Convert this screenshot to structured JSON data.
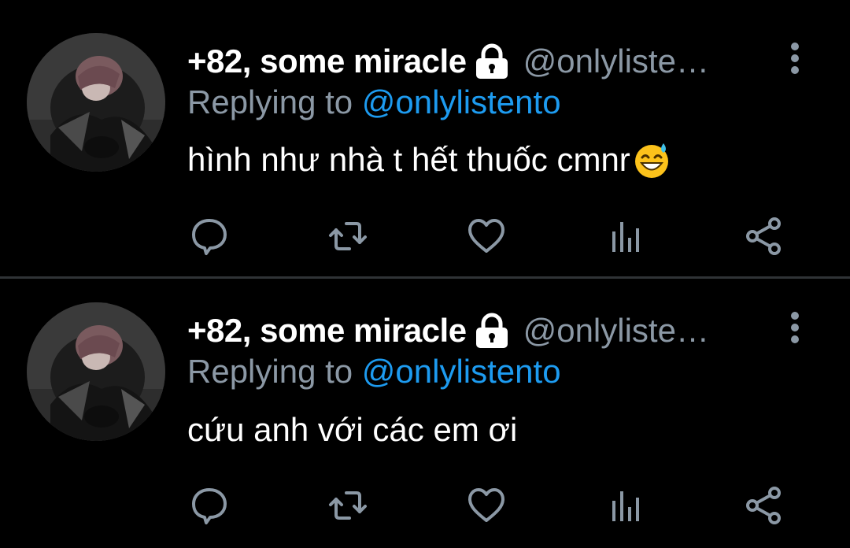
{
  "tweets": [
    {
      "display_name": "+82, some miracle",
      "handle": "@onlyliste…",
      "replying_prefix": "Replying to",
      "replying_to": "@onlylistento",
      "text": "hình như nhà t hết thuốc cmnr",
      "emoji": "grinning-face-with-sweat-emoji",
      "avatar": "avatar-image"
    },
    {
      "display_name": "+82, some miracle",
      "handle": "@onlyliste…",
      "replying_prefix": "Replying to",
      "replying_to": "@onlylistento",
      "text": "cứu anh với các em ơi",
      "avatar": "avatar-image"
    }
  ],
  "icons": {
    "lock": "lock-icon",
    "more": "more-vertical-icon",
    "reply": "reply-icon",
    "retweet": "retweet-icon",
    "like": "heart-icon",
    "analytics": "analytics-icon",
    "share": "share-icon"
  },
  "colors": {
    "background": "#000000",
    "primary_text": "#ffffff",
    "secondary_text": "#8b98a5",
    "mention": "#1d9bf0",
    "divider": "#2f3336",
    "icon": "#8b98a5"
  }
}
